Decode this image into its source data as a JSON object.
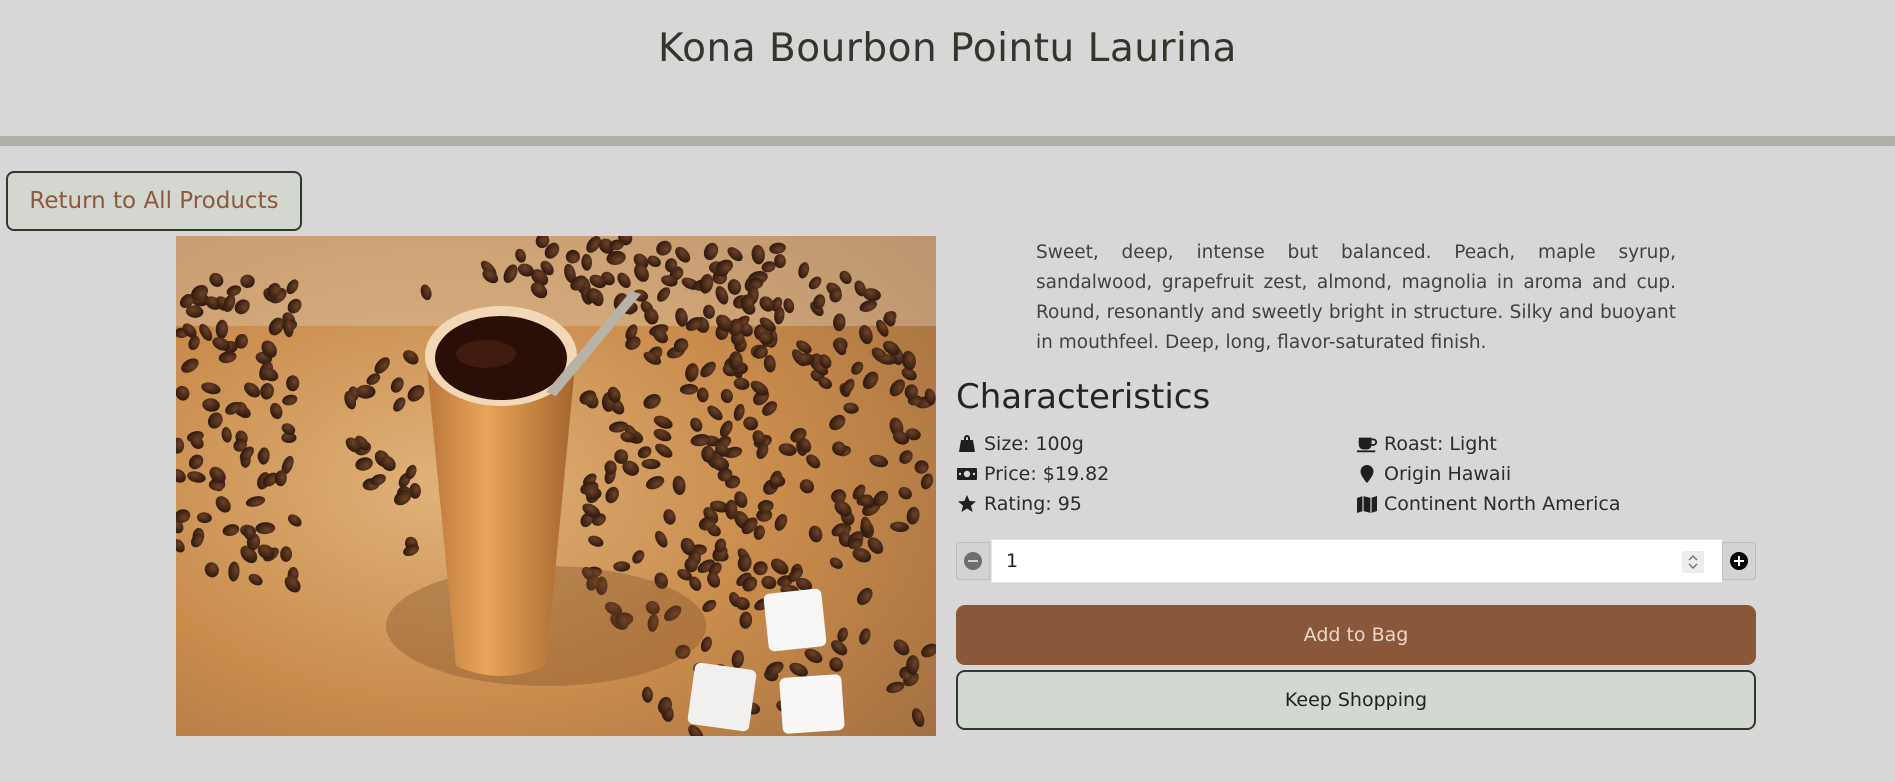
{
  "header": {
    "title": "Kona Bourbon Pointu Laurina"
  },
  "nav": {
    "return_label": "Return to All Products"
  },
  "product": {
    "description": "Sweet, deep, intense but balanced. Peach, maple syrup, sandalwood, grapefruit zest, almond, magnolia in aroma and cup. Round, resonantly and sweetly bright in structure. Silky and buoyant in mouthfeel. Deep, long, flavor-saturated finish.",
    "characteristics_title": "Characteristics",
    "characteristics": {
      "size": "Size: 100g",
      "price": "Price: $19.82",
      "rating": "Rating: 95",
      "roast": "Roast: Light",
      "origin": "Origin Hawaii",
      "continent": "Continent North America"
    },
    "icons": {
      "size": "weight-bag-icon",
      "price": "money-bill-icon",
      "rating": "star-icon",
      "roast": "coffee-cup-icon",
      "origin": "map-marker-icon",
      "continent": "map-icon"
    }
  },
  "quantity": {
    "value": "1"
  },
  "actions": {
    "add_label": "Add to Bag",
    "keep_label": "Keep Shopping"
  },
  "colors": {
    "background": "#d8d6d7",
    "brand_brown": "#8b573b",
    "border_green": "#2f3a2d",
    "button_light": "#d3d8d0"
  }
}
